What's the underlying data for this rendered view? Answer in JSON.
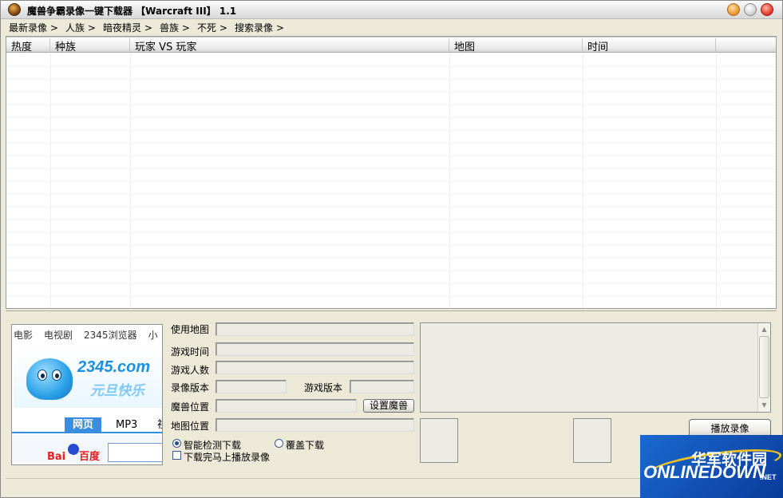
{
  "window": {
    "title": "魔兽争霸录像一键下载器 【Warcraft III】 1.1"
  },
  "menu": {
    "items": [
      "最新录像 >",
      "人族 >",
      "暗夜精灵 >",
      "兽族 >",
      "不死 >",
      "搜索录像 >"
    ]
  },
  "list": {
    "columns": [
      "热度",
      "种族",
      "玩家 VS 玩家",
      "地图",
      "时间"
    ]
  },
  "ad": {
    "tabs": [
      "电影",
      "电视剧",
      "2345浏览器",
      "小"
    ],
    "logo": "2345.com",
    "slogan": "元旦快乐",
    "search_tabs": [
      "网页",
      "MP3",
      "视"
    ],
    "baidu_text": "Bai",
    "baidu_du": "du",
    "baidu_cn": "百度"
  },
  "form": {
    "map_used_label": "使用地图",
    "game_time_label": "游戏时间",
    "players_label": "游戏人数",
    "replay_version_label": "录像版本",
    "game_version_label": "游戏版本",
    "wc3_location_label": "魔兽位置",
    "set_wc3_button": "设置魔兽",
    "map_location_label": "地图位置",
    "smart_detect_label": "智能检测下载",
    "overwrite_label": "覆盖下载",
    "play_after_download_label": "下载完马上播放录像",
    "play_button": "播放录像"
  },
  "watermark": {
    "cn": "华军软件园",
    "en": "ONLINEDOWN",
    "net": ".NET"
  },
  "colors": {
    "window_bg": "#ece9d8",
    "list_bg": "#ffffff",
    "field_bg": "#ebebe4",
    "watermark_bg": "#1a5ac0",
    "watermark_accent": "#f0c020"
  }
}
